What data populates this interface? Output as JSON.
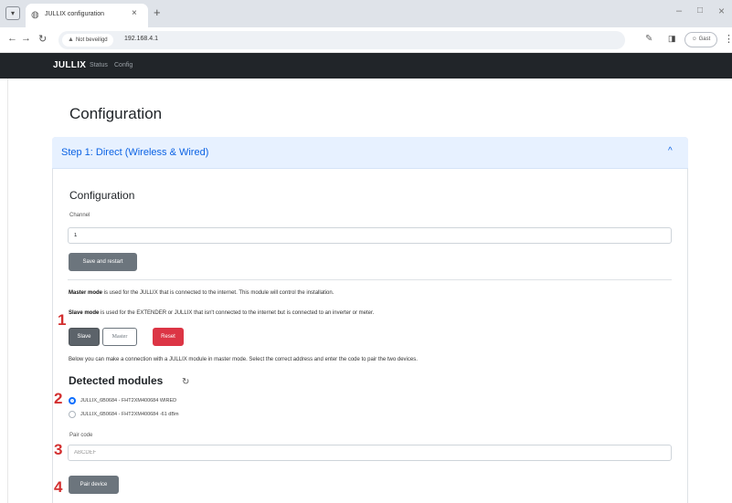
{
  "browser": {
    "tab_title": "JULLIX configuration",
    "security_label": "Not beveiligd",
    "url": "192.168.4.1",
    "profile_label": "Gast",
    "new_tab_glyph": "+",
    "close_glyph": "×"
  },
  "navbar": {
    "brand": "JULLIX",
    "links": [
      "Status",
      "Config"
    ]
  },
  "page": {
    "title": "Configuration"
  },
  "accordion": {
    "title": "Step 1: Direct (Wireless & Wired)",
    "chevron": "^"
  },
  "config": {
    "title": "Configuration",
    "channel_label": "Channel",
    "channel_value": "1",
    "save_label": "Save and restart"
  },
  "modes": {
    "master_term": "Master mode",
    "master_text": " is used for the JULLIX that is connected to the internet. This module will control the installation.",
    "slave_term": "Slave mode",
    "slave_text": " is used for the EXTENDER or JULLIX that isn't connected to the internet but is connected to an inverter or meter.",
    "slave_button": "Slave",
    "master_button": "Master",
    "reset_button": "Reset",
    "below_text": "Below you can make a connection with a JULLIX module in master mode. Select the correct address and enter the code to pair the two devices."
  },
  "modules": {
    "title": "Detected modules",
    "items": [
      {
        "label": "JULLIX_6B0684 - FHT2XM400684 WIRED",
        "selected": true
      },
      {
        "label": "JULLIX_6B0684 - FHT2XM400684 -61 dBm",
        "selected": false
      }
    ],
    "pair_label": "Pair code",
    "pair_placeholder": "ABCDEF",
    "pair_button": "Pair device"
  },
  "annotations": [
    "1",
    "2",
    "3",
    "4"
  ],
  "colors": {
    "navbar_bg": "#212529",
    "accordion_header_bg": "#e7f1ff",
    "accordion_title": "#0c63e4",
    "secondary_button": "#6c757d",
    "danger_button": "#dc3545",
    "radio_selected": "#0d6efd",
    "annotation_red": "#d32f2f"
  },
  "icons": {
    "tab_menu": "tab-menu-icon",
    "favicon": "globe-icon",
    "back": "arrow-left-icon",
    "forward": "arrow-right-icon",
    "reload": "reload-icon",
    "warning": "warning-triangle-icon",
    "refresh": "refresh-icon"
  }
}
